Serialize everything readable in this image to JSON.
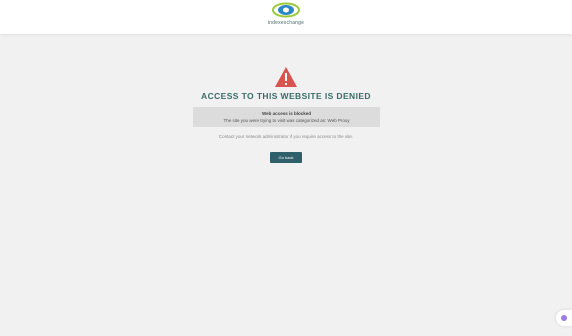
{
  "header": {
    "logo_text": "indexexchange"
  },
  "main": {
    "headline": "ACCESS TO THIS WEBSITE IS DENIED",
    "info_line1": "Web access is blocked",
    "info_line2": "The site you were trying to visit was categorized as: Web Proxy",
    "note": "Contact your network administrator if you require access to the site.",
    "button_label": "Go back"
  },
  "colors": {
    "accent": "#2f5f6a",
    "warning": "#d9534f",
    "headline": "#3a6b68",
    "chat": "#9b7be8"
  }
}
